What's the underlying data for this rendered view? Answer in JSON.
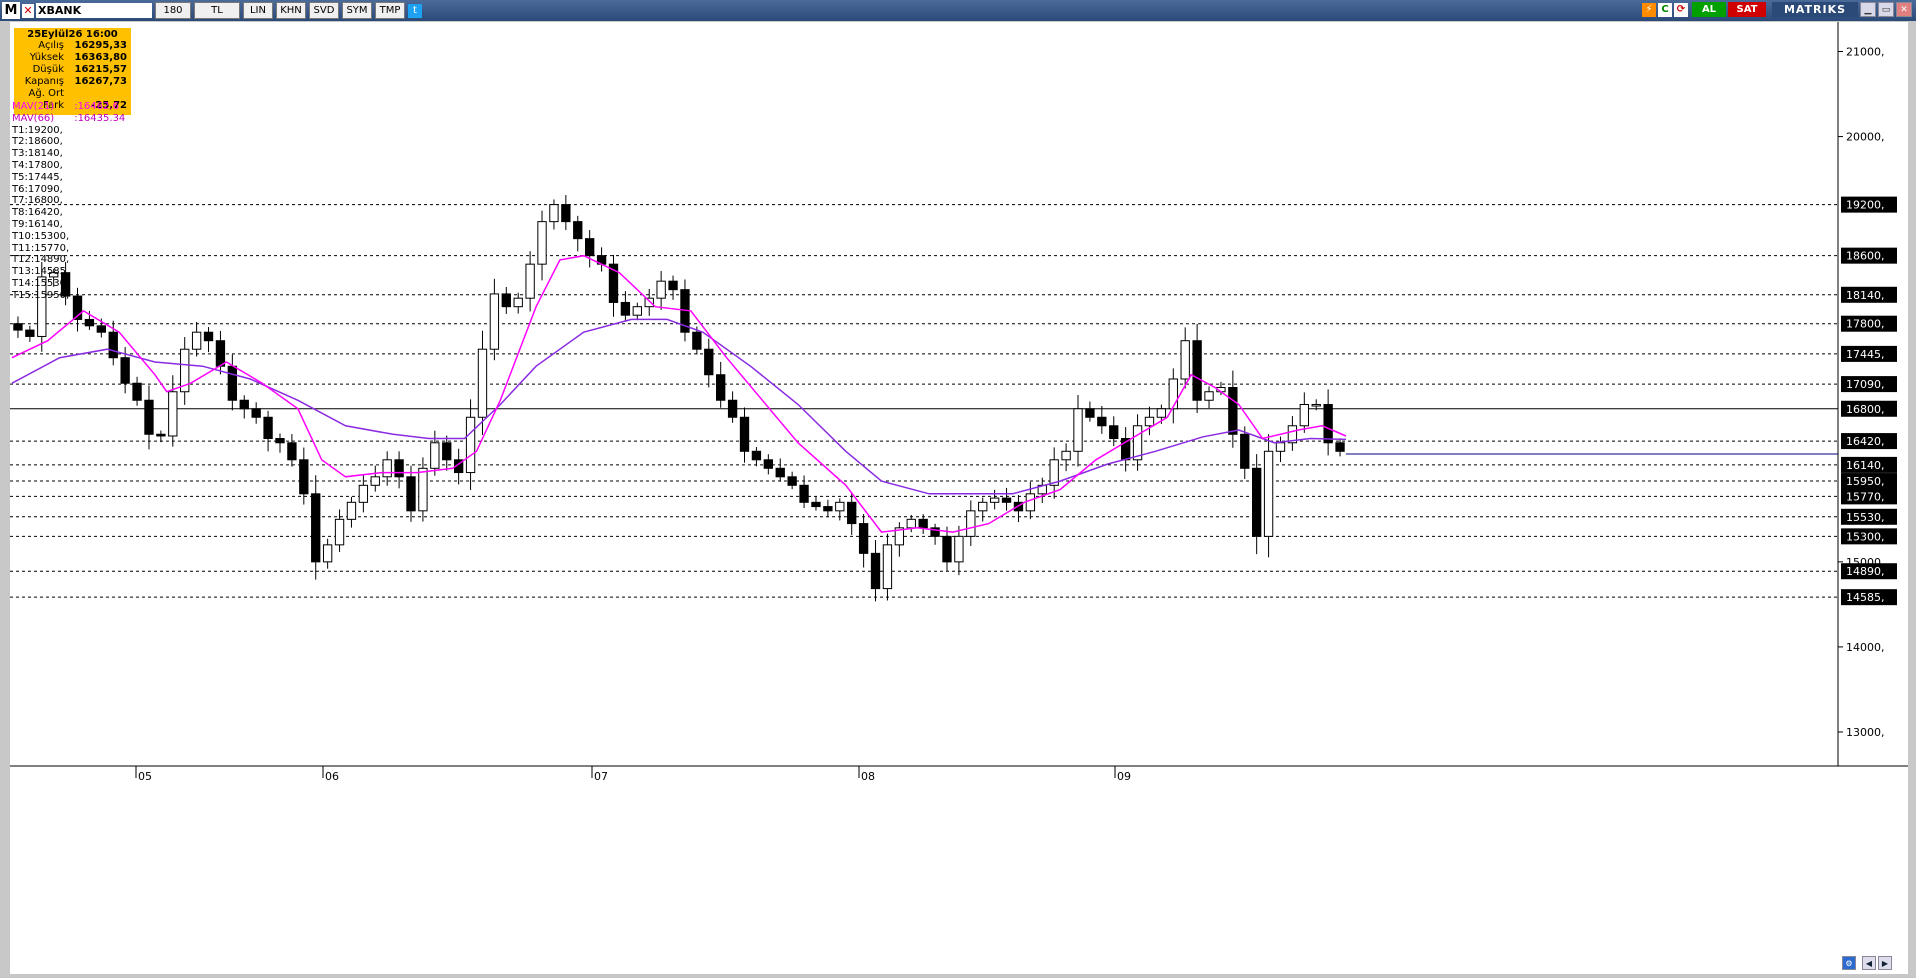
{
  "toolbar": {
    "menu": "M",
    "symbol": "XBANK",
    "period": "180",
    "currency": "TL",
    "buttons": [
      "LIN",
      "KHN",
      "SVD",
      "SYM",
      "TMP"
    ],
    "buy": "AL",
    "sell": "SAT",
    "brand": "MATRIKS",
    "icons": [
      "flame-icon",
      "refresh-icon",
      "minimize-icon",
      "restore-icon",
      "close-icon",
      "twitter-icon",
      "lightning-icon"
    ]
  },
  "info": {
    "title": "25Eylül26 16:00",
    "rows": [
      {
        "k": "Açılış",
        "v": "16295,33"
      },
      {
        "k": "Yüksek",
        "v": "16363,80"
      },
      {
        "k": "Düşük",
        "v": "16215,57"
      },
      {
        "k": "Kapanış",
        "v": "16267,73"
      },
      {
        "k": "Ağ. Ort",
        "v": ""
      },
      {
        "k": "Fark",
        "v": "-25,72"
      }
    ]
  },
  "colors": {
    "mav21": "#ff00ff",
    "mav66": "#8a2be2",
    "candle": "#000000",
    "lastline": "#000080",
    "info_bg": "#ffc000"
  },
  "chart_data": {
    "type": "candlestick",
    "symbol": "XBANK",
    "ylim": [
      12600,
      21300
    ],
    "y_ticks": [
      13000,
      14000,
      15000,
      20000,
      21000
    ],
    "x_ticks": [
      "05",
      "06",
      "07",
      "08",
      "09"
    ],
    "mav_labels": [
      {
        "name": "MAV(21)",
        "value": ":16462.6"
      },
      {
        "name": "MAV(66)",
        "value": ":16435.34"
      }
    ],
    "targets": [
      {
        "name": "T1",
        "value": 19200
      },
      {
        "name": "T2",
        "value": 18600
      },
      {
        "name": "T3",
        "value": 18140
      },
      {
        "name": "T4",
        "value": 17800
      },
      {
        "name": "T5",
        "value": 17445
      },
      {
        "name": "T6",
        "value": 17090
      },
      {
        "name": "T7",
        "value": 16800
      },
      {
        "name": "T8",
        "value": 16420
      },
      {
        "name": "T9",
        "value": 16140
      },
      {
        "name": "T10",
        "value": 15300
      },
      {
        "name": "T11",
        "value": 15770
      },
      {
        "name": "T12",
        "value": 14890
      },
      {
        "name": "T13",
        "value": 14585
      },
      {
        "name": "T14",
        "value": 15530
      },
      {
        "name": "T15",
        "value": 15950
      }
    ],
    "target_suffix": ",",
    "solid_line": 16800,
    "last_close": 16267.73,
    "series_path": [
      [
        0,
        17800
      ],
      [
        2,
        17650
      ],
      [
        3,
        18350
      ],
      [
        4,
        18400
      ],
      [
        6,
        17850
      ],
      [
        8,
        17700
      ],
      [
        9,
        17400
      ],
      [
        10,
        17100
      ],
      [
        11,
        16900
      ],
      [
        12,
        16500
      ],
      [
        13,
        16480
      ],
      [
        14,
        17000
      ],
      [
        15,
        17500
      ],
      [
        16,
        17700
      ],
      [
        17,
        17600
      ],
      [
        18,
        17300
      ],
      [
        19,
        16900
      ],
      [
        20,
        16800
      ],
      [
        21,
        16700
      ],
      [
        22,
        16450
      ],
      [
        23,
        16400
      ],
      [
        24,
        16200
      ],
      [
        25,
        15800
      ],
      [
        26,
        15000
      ],
      [
        26.5,
        14700
      ],
      [
        27,
        15200
      ],
      [
        28,
        15500
      ],
      [
        29,
        15700
      ],
      [
        30,
        15900
      ],
      [
        31,
        16000
      ],
      [
        32,
        16200
      ],
      [
        33,
        16000
      ],
      [
        34,
        15600
      ],
      [
        35,
        16100
      ],
      [
        36,
        16400
      ],
      [
        37,
        16200
      ],
      [
        38,
        16050
      ],
      [
        39,
        16700
      ],
      [
        40,
        17500
      ],
      [
        41,
        18150
      ],
      [
        42,
        18000
      ],
      [
        43,
        18100
      ],
      [
        44,
        18500
      ],
      [
        45,
        19000
      ],
      [
        46,
        19200
      ],
      [
        47,
        19000
      ],
      [
        48,
        18800
      ],
      [
        49,
        18600
      ],
      [
        50,
        18500
      ],
      [
        51,
        18050
      ],
      [
        52,
        17900
      ],
      [
        53,
        18000
      ],
      [
        54,
        18100
      ],
      [
        55,
        18300
      ],
      [
        56,
        18200
      ],
      [
        57,
        17700
      ],
      [
        58,
        17500
      ],
      [
        59,
        17200
      ],
      [
        60,
        16900
      ],
      [
        61,
        16700
      ],
      [
        62,
        16300
      ],
      [
        63,
        16200
      ],
      [
        64,
        16100
      ],
      [
        65,
        16000
      ],
      [
        66,
        15900
      ],
      [
        67,
        15700
      ],
      [
        68,
        15650
      ],
      [
        69,
        15600
      ],
      [
        70,
        15700
      ],
      [
        71,
        15450
      ],
      [
        72,
        15100
      ],
      [
        72.8,
        14700
      ],
      [
        73.5,
        14650
      ],
      [
        74,
        15200
      ],
      [
        75,
        15400
      ],
      [
        76,
        15500
      ],
      [
        77,
        15400
      ],
      [
        78,
        15300
      ],
      [
        79,
        15000
      ],
      [
        80,
        15300
      ],
      [
        81,
        15600
      ],
      [
        82,
        15700
      ],
      [
        83,
        15750
      ],
      [
        84,
        15700
      ],
      [
        85,
        15600
      ],
      [
        86,
        15800
      ],
      [
        87,
        15900
      ],
      [
        88,
        16200
      ],
      [
        89,
        16300
      ],
      [
        90,
        16800
      ],
      [
        91,
        16700
      ],
      [
        92,
        16600
      ],
      [
        93,
        16450
      ],
      [
        94,
        16200
      ],
      [
        95,
        16600
      ],
      [
        96,
        16700
      ],
      [
        97,
        16800
      ],
      [
        98,
        17150
      ],
      [
        99,
        17600
      ],
      [
        100,
        16900
      ],
      [
        101,
        17000
      ],
      [
        102,
        17050
      ],
      [
        103,
        16500
      ],
      [
        104,
        16100
      ],
      [
        104.5,
        15100
      ],
      [
        105,
        15300
      ],
      [
        106,
        16300
      ],
      [
        107,
        16400
      ],
      [
        108,
        16600
      ],
      [
        109,
        16850
      ],
      [
        110,
        16850
      ],
      [
        111,
        16400
      ],
      [
        112,
        16300
      ]
    ],
    "mav21_path": [
      [
        0,
        17400
      ],
      [
        3,
        17600
      ],
      [
        6,
        17950
      ],
      [
        9,
        17700
      ],
      [
        12,
        17200
      ],
      [
        13,
        17000
      ],
      [
        15,
        17100
      ],
      [
        18,
        17350
      ],
      [
        21,
        17100
      ],
      [
        24,
        16800
      ],
      [
        26,
        16200
      ],
      [
        28,
        16000
      ],
      [
        31,
        16050
      ],
      [
        34,
        16050
      ],
      [
        37,
        16100
      ],
      [
        39,
        16300
      ],
      [
        41,
        16900
      ],
      [
        44,
        18000
      ],
      [
        46,
        18550
      ],
      [
        48,
        18600
      ],
      [
        51,
        18400
      ],
      [
        54,
        18000
      ],
      [
        57,
        17950
      ],
      [
        60,
        17400
      ],
      [
        63,
        16900
      ],
      [
        66,
        16400
      ],
      [
        70,
        15900
      ],
      [
        73,
        15350
      ],
      [
        76,
        15400
      ],
      [
        79,
        15350
      ],
      [
        82,
        15450
      ],
      [
        85,
        15700
      ],
      [
        88,
        15850
      ],
      [
        91,
        16200
      ],
      [
        94,
        16450
      ],
      [
        97,
        16700
      ],
      [
        99,
        17200
      ],
      [
        101,
        17050
      ],
      [
        103,
        16850
      ],
      [
        105,
        16450
      ],
      [
        108,
        16550
      ],
      [
        110,
        16600
      ],
      [
        112,
        16480
      ]
    ],
    "mav66_path": [
      [
        0,
        17100
      ],
      [
        4,
        17400
      ],
      [
        8,
        17500
      ],
      [
        12,
        17350
      ],
      [
        16,
        17300
      ],
      [
        20,
        17150
      ],
      [
        24,
        16900
      ],
      [
        28,
        16600
      ],
      [
        32,
        16500
      ],
      [
        35,
        16450
      ],
      [
        38,
        16450
      ],
      [
        41,
        16850
      ],
      [
        44,
        17300
      ],
      [
        48,
        17700
      ],
      [
        52,
        17850
      ],
      [
        55,
        17850
      ],
      [
        58,
        17700
      ],
      [
        62,
        17300
      ],
      [
        66,
        16850
      ],
      [
        70,
        16300
      ],
      [
        73,
        15950
      ],
      [
        77,
        15800
      ],
      [
        80,
        15800
      ],
      [
        84,
        15800
      ],
      [
        88,
        15950
      ],
      [
        92,
        16150
      ],
      [
        96,
        16300
      ],
      [
        100,
        16470
      ],
      [
        103,
        16550
      ],
      [
        106,
        16400
      ],
      [
        109,
        16450
      ],
      [
        112,
        16440
      ]
    ]
  }
}
